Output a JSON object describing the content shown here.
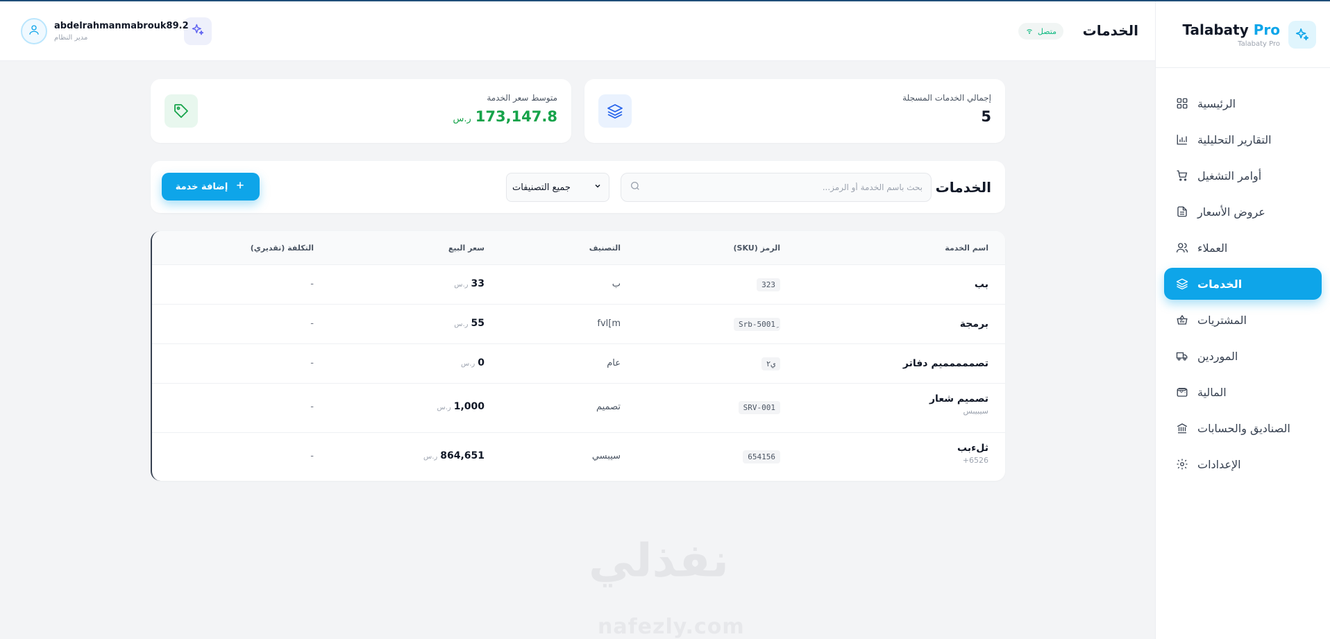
{
  "brand": {
    "name_main": "Talabaty",
    "name_accent": " Pro",
    "subtitle": "Talabaty Pro"
  },
  "sidebar": {
    "items": [
      {
        "label": "الرئيسية",
        "icon": "grid-icon"
      },
      {
        "label": "التقارير التحليلية",
        "icon": "bar-chart-icon"
      },
      {
        "label": "أوامر التشغيل",
        "icon": "cart-icon"
      },
      {
        "label": "عروض الأسعار",
        "icon": "document-icon"
      },
      {
        "label": "العملاء",
        "icon": "users-icon"
      },
      {
        "label": "الخدمات",
        "icon": "layers-icon",
        "active": true
      },
      {
        "label": "المشتريات",
        "icon": "basket-icon",
        "expandable": true
      },
      {
        "label": "الموردين",
        "icon": "truck-icon"
      },
      {
        "label": "المالية",
        "icon": "wallet-icon",
        "expandable": true
      },
      {
        "label": "الصناديق والحسابات",
        "icon": "bank-icon"
      },
      {
        "label": "الإعدادات",
        "icon": "gear-icon"
      }
    ]
  },
  "header": {
    "title": "الخدمات",
    "status": "متصل",
    "user": {
      "name": "abdelrahmanmabrouk89.2",
      "role": "مدير النظام"
    }
  },
  "stats": {
    "total_label": "إجمالي الخدمات المسجلة",
    "total_value": "5",
    "avg_label": "متوسط سعر الخدمة",
    "avg_value": "173,147.8",
    "avg_currency": "ر.س"
  },
  "toolbar": {
    "title": "الخدمات",
    "search_placeholder": "بحث باسم الخدمة أو الرمز...",
    "category_value": "جميع التصنيفات",
    "add_label": "إضافة خدمة"
  },
  "table": {
    "headers": {
      "name": "اسم الخدمة",
      "sku": "الرمز (SKU)",
      "category": "التصنيف",
      "price": "سعر البيع",
      "cost": "التكلفة (تقديري)"
    },
    "currency": "ر.س",
    "rows": [
      {
        "name": "بب",
        "sub": "",
        "sku": "323",
        "category": "ب",
        "price": "33",
        "cost": "-"
      },
      {
        "name": "برمجة",
        "sub": "",
        "sku": "Srb-5001ِ",
        "category": "fvl[m",
        "price": "55",
        "cost": "-"
      },
      {
        "name": "تصممممميم دفاتر",
        "sub": "",
        "sku": "ي٢",
        "category": "عام",
        "price": "0",
        "cost": "-"
      },
      {
        "name": "تصميم شعار",
        "sub": "سيبيبس",
        "sku": "SRV-001",
        "category": "تصميم",
        "price": "1,000",
        "cost": "-"
      },
      {
        "name": "ثلءبب",
        "sub": "+6526",
        "sku": "654156",
        "category": "سيبسي",
        "price": "864,651",
        "cost": "-"
      }
    ]
  },
  "watermark": {
    "arabic": "نفذلي",
    "latin": "nafezly.com"
  },
  "colors": {
    "accent": "#0ea5e9",
    "success": "#16a34a",
    "border": "#e5e7eb",
    "background": "#f3f4f6"
  }
}
